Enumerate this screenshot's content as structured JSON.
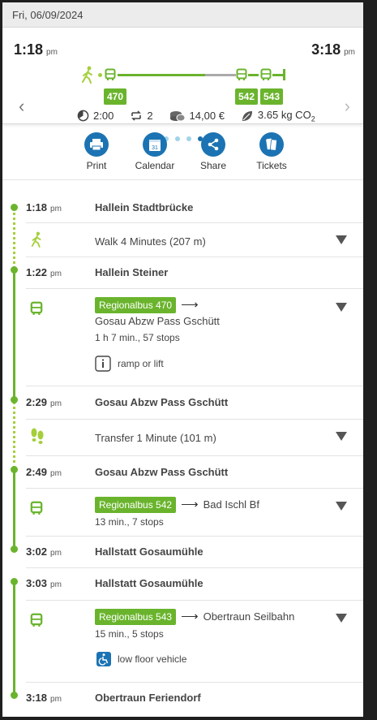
{
  "date": "Fri, 06/09/2024",
  "summary": {
    "depart_time": "1:18",
    "arrive_time": "3:18",
    "period": "pm",
    "lines": [
      "470",
      "542",
      "543"
    ],
    "duration": "2:00",
    "transfers": "2",
    "price": "14,00 €",
    "co2": "3.65 kg CO",
    "co2_sub": "2",
    "prev_icon": "chevron-left-icon",
    "next_icon": "chevron-right-icon"
  },
  "pager": {
    "count": 4,
    "active": 3
  },
  "actions": [
    {
      "label": "Print",
      "icon": "printer-icon"
    },
    {
      "label": "Calendar",
      "icon": "calendar-icon",
      "icon_text": "31"
    },
    {
      "label": "Share",
      "icon": "share-icon"
    },
    {
      "label": "Tickets",
      "icon": "tickets-icon"
    }
  ],
  "timeline": {
    "stop1": {
      "time": "1:18",
      "period": "pm",
      "name": "Hallein Stadtbrücke"
    },
    "walk": {
      "text": "Walk 4 Minutes (207 m)"
    },
    "stop2": {
      "time": "1:22",
      "period": "pm",
      "name": "Hallein Steiner"
    },
    "bus1": {
      "line": "Regionalbus 470",
      "direction": "Gosau Abzw Pass Gschütt",
      "duration": "1 h 7 min., 57 stops",
      "feature": "ramp or lift"
    },
    "stop3": {
      "time": "2:29",
      "period": "pm",
      "name": "Gosau Abzw Pass Gschütt"
    },
    "transfer": {
      "text": "Transfer 1 Minute (101 m)"
    },
    "stop4": {
      "time": "2:49",
      "period": "pm",
      "name": "Gosau Abzw Pass Gschütt"
    },
    "bus2": {
      "line": "Regionalbus 542",
      "direction": "Bad Ischl Bf",
      "duration": "13 min., 7 stops"
    },
    "stop5": {
      "time": "3:02",
      "period": "pm",
      "name": "Hallstatt Gosaumühle"
    },
    "stop6": {
      "time": "3:03",
      "period": "pm",
      "name": "Hallstatt Gosaumühle"
    },
    "bus3": {
      "line": "Regionalbus 543",
      "direction": "Obertraun Seilbahn",
      "duration": "15 min., 5 stops",
      "feature": "low floor vehicle"
    },
    "stop7": {
      "time": "3:18",
      "period": "pm",
      "name": "Obertraun Feriendorf"
    }
  },
  "colors": {
    "green": "#6ab42d",
    "blue": "#1c73b3",
    "lime": "#a4cf3a"
  }
}
